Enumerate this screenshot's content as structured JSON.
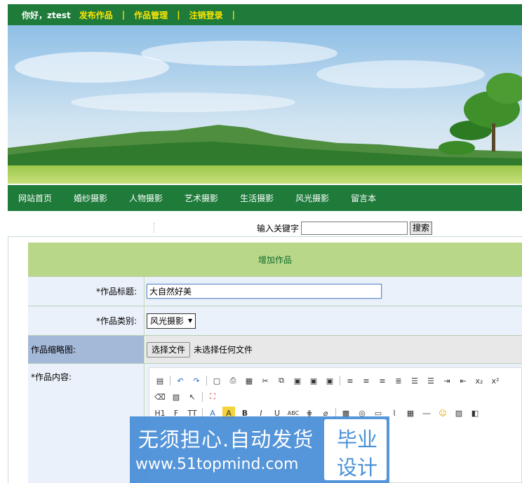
{
  "topbar": {
    "greeting": "你好，",
    "username": "ztest",
    "links": [
      "发布作品",
      "作品管理",
      "注销登录"
    ],
    "separator": "|"
  },
  "nav": {
    "items": [
      "网站首页",
      "婚纱摄影",
      "人物摄影",
      "艺术摄影",
      "生活摄影",
      "风光摄影",
      "留言本"
    ]
  },
  "search": {
    "label": "输入关键字",
    "value": "",
    "button": "搜索"
  },
  "form": {
    "heading": "增加作品",
    "title_label": "*作品标题:",
    "title_value": "大自然好美",
    "category_label": "*作品类别:",
    "category_value": "风光摄影",
    "thumbnail_label": "作品缩略图:",
    "file_button": "选择文件",
    "file_status": "未选择任何文件",
    "content_label": "*作品内容:"
  },
  "watermark": {
    "slogan": "无须担心.自动发货",
    "url": "www.51topmind.com",
    "tag_line1": "毕业",
    "tag_line2": "设计"
  },
  "colors": {
    "green": "#1e7b3a",
    "link_yellow": "#ffe600",
    "header_green": "#b9d788",
    "row_blue": "#eaf1fa"
  }
}
